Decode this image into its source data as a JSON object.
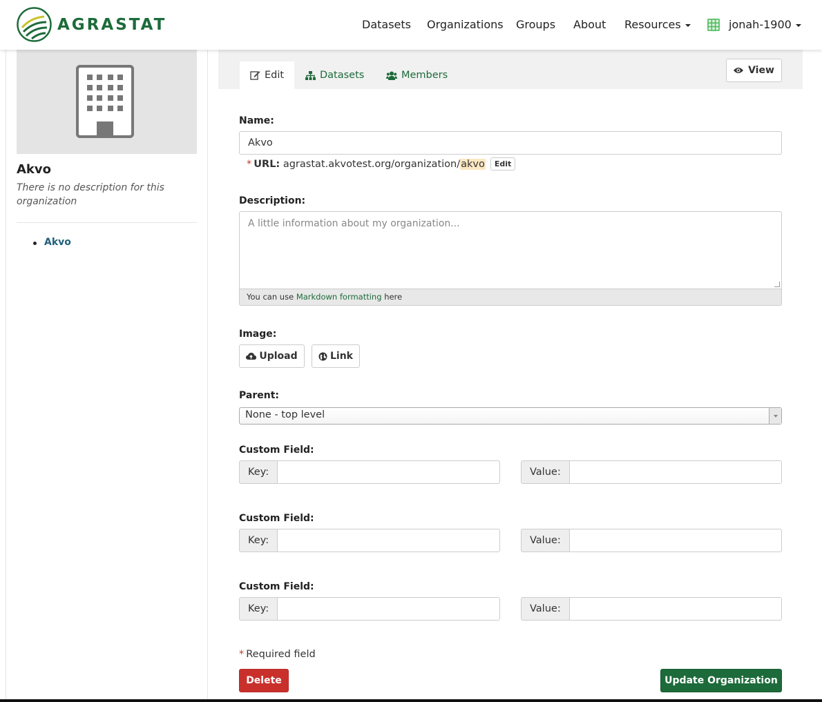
{
  "header": {
    "brand": "AGRASTAT",
    "nav": [
      {
        "label": "Datasets"
      },
      {
        "label": "Organizations"
      },
      {
        "label": "Groups"
      },
      {
        "label": "About"
      },
      {
        "label": "Resources"
      }
    ],
    "user": "jonah-1900"
  },
  "sidebar": {
    "title": "Akvo",
    "description": "There is no description for this organization",
    "links": [
      {
        "label": "Akvo"
      }
    ]
  },
  "tabs": [
    {
      "label": "Edit",
      "icon": "edit-icon",
      "active": true
    },
    {
      "label": "Datasets",
      "icon": "sitemap-icon",
      "active": false
    },
    {
      "label": "Members",
      "icon": "users-icon",
      "active": false
    }
  ],
  "view_button": "View",
  "form": {
    "name_label": "Name:",
    "name_value": "Akvo",
    "url_label": "URL:",
    "url_prefix": "agrastat.akvotest.org/organization/",
    "url_slug": "akvo",
    "url_edit": "Edit",
    "description_label": "Description:",
    "description_placeholder": "A little information about my organization...",
    "markdown_hint_prefix": "You can use",
    "markdown_link": "Markdown formatting",
    "markdown_hint_suffix": "here",
    "image_label": "Image:",
    "upload_label": "Upload",
    "link_label": "Link",
    "parent_label": "Parent:",
    "parent_value": "None - top level",
    "custom_fields": [
      {
        "label": "Custom Field:",
        "key_label": "Key:",
        "value_label": "Value:"
      },
      {
        "label": "Custom Field:",
        "key_label": "Key:",
        "value_label": "Value:"
      },
      {
        "label": "Custom Field:",
        "key_label": "Key:",
        "value_label": "Value:"
      }
    ],
    "required_marker": "*",
    "required_note": "Required field",
    "delete_label": "Delete",
    "update_label": "Update Organization"
  },
  "colors": {
    "brand_green": "#1d6b3a",
    "danger": "#c9302c",
    "link_blue": "#1f5f7a"
  }
}
